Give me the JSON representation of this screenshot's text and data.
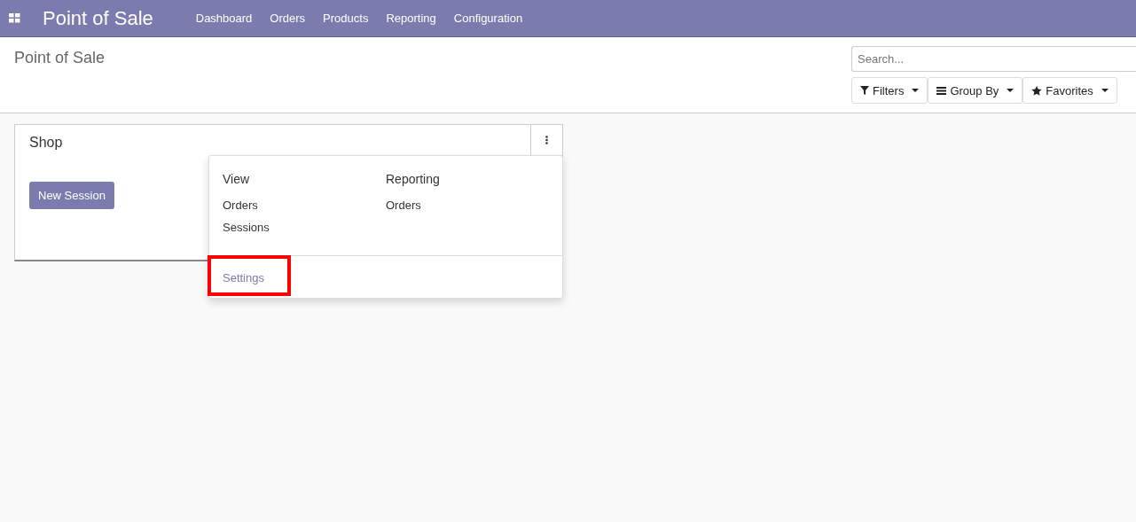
{
  "navbar": {
    "app_title": "Point of Sale",
    "menu": [
      "Dashboard",
      "Orders",
      "Products",
      "Reporting",
      "Configuration"
    ]
  },
  "control_panel": {
    "breadcrumb": "Point of Sale",
    "search": {
      "placeholder": "Search..."
    },
    "buttons": [
      {
        "kind": "filter",
        "label": "Filters"
      },
      {
        "kind": "group",
        "label": "Group By"
      },
      {
        "kind": "favorite",
        "label": "Favorites"
      }
    ]
  },
  "card": {
    "title": "Shop",
    "primary_button": "New Session",
    "dropdown": {
      "expanded": true,
      "columns": [
        {
          "heading": "View",
          "items": [
            "Orders",
            "Sessions"
          ]
        },
        {
          "heading": "Reporting",
          "items": [
            "Orders"
          ]
        }
      ],
      "settings": {
        "label": "Settings",
        "highlighted": true
      }
    }
  }
}
